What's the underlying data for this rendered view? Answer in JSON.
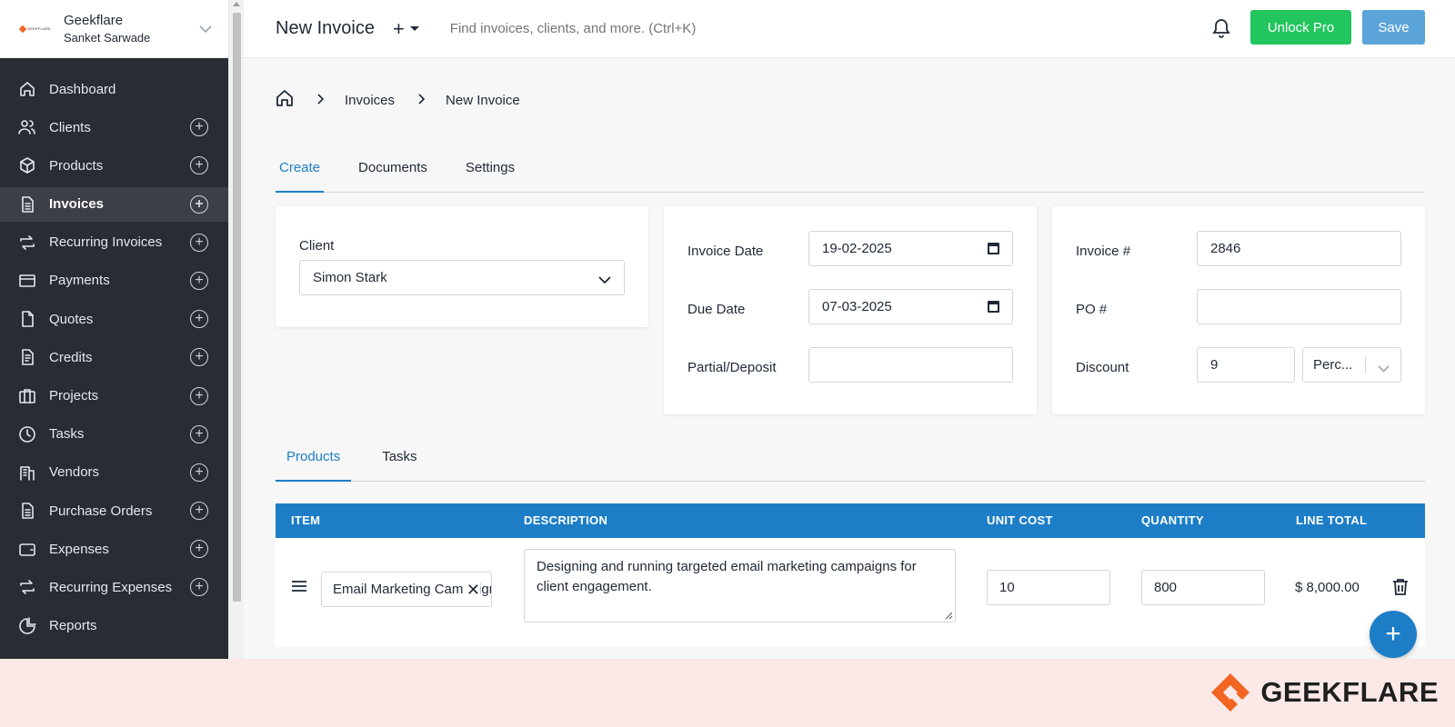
{
  "sidebar": {
    "company": "Geekflare",
    "user": "Sanket Sarwade",
    "logo_text": "GEEKFLARE",
    "items": [
      {
        "label": "Dashboard",
        "icon": "home-icon",
        "add": false
      },
      {
        "label": "Clients",
        "icon": "users-icon",
        "add": true
      },
      {
        "label": "Products",
        "icon": "box-icon",
        "add": true
      },
      {
        "label": "Invoices",
        "icon": "file-icon",
        "add": true,
        "active": true
      },
      {
        "label": "Recurring Invoices",
        "icon": "repeat-icon",
        "add": true
      },
      {
        "label": "Payments",
        "icon": "credit-card-icon",
        "add": true
      },
      {
        "label": "Quotes",
        "icon": "document-icon",
        "add": true
      },
      {
        "label": "Credits",
        "icon": "file-text-icon",
        "add": true
      },
      {
        "label": "Projects",
        "icon": "briefcase-icon",
        "add": true
      },
      {
        "label": "Tasks",
        "icon": "clock-icon",
        "add": true
      },
      {
        "label": "Vendors",
        "icon": "building-icon",
        "add": true
      },
      {
        "label": "Purchase Orders",
        "icon": "file-list-icon",
        "add": true
      },
      {
        "label": "Expenses",
        "icon": "wallet-icon",
        "add": true
      },
      {
        "label": "Recurring Expenses",
        "icon": "repeat-icon",
        "add": true
      },
      {
        "label": "Reports",
        "icon": "pie-chart-icon",
        "add": false
      }
    ]
  },
  "header": {
    "title": "New Invoice",
    "search_placeholder": "Find invoices, clients, and more. (Ctrl+K)",
    "unlock_label": "Unlock Pro",
    "save_label": "Save"
  },
  "breadcrumb": [
    "Invoices",
    "New Invoice"
  ],
  "tabs": [
    "Create",
    "Documents",
    "Settings"
  ],
  "client": {
    "label": "Client",
    "value": "Simon Stark"
  },
  "dates": {
    "invoice_date_label": "Invoice Date",
    "invoice_date": "19-02-2025",
    "due_date_label": "Due Date",
    "due_date": "07-03-2025",
    "partial_label": "Partial/Deposit",
    "partial": ""
  },
  "numbers": {
    "invoice_no_label": "Invoice #",
    "invoice_no": "2846",
    "po_label": "PO #",
    "po": "",
    "discount_label": "Discount",
    "discount": "9",
    "discount_type": "Perc..."
  },
  "product_tabs": [
    "Products",
    "Tasks"
  ],
  "table": {
    "headers": [
      "ITEM",
      "DESCRIPTION",
      "UNIT COST",
      "QUANTITY",
      "LINE TOTAL"
    ],
    "rows": [
      {
        "item": "Email Marketing Campaign",
        "description": "Designing and running targeted email marketing campaigns for client engagement.",
        "unit_cost": "10",
        "quantity": "800",
        "line_total": "$ 8,000.00"
      }
    ]
  },
  "banner": {
    "brand": "GEEKFLARE"
  },
  "colors": {
    "accent": "#1d7ec7",
    "pro": "#22c55e",
    "save": "#5ba4d9",
    "sidebar": "#282c33"
  }
}
